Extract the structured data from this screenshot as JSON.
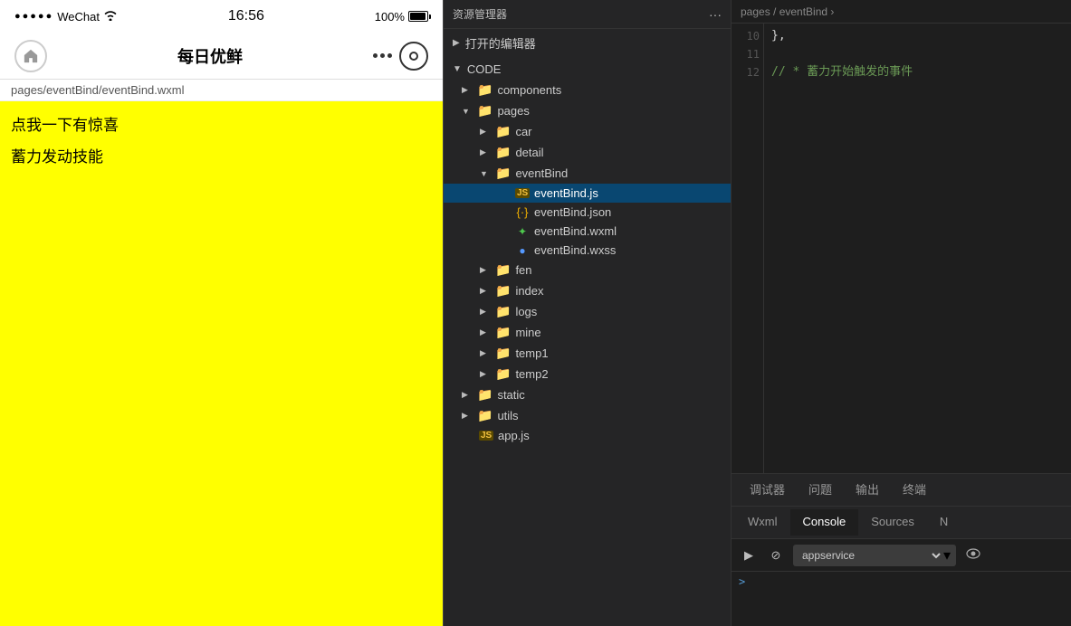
{
  "mobile": {
    "status": {
      "signal_dots": "●●●●●",
      "app_name": "WeChat",
      "wifi_icon": "wifi",
      "time": "16:56",
      "battery_pct": "100%"
    },
    "nav": {
      "title": "每日优鲜",
      "home_icon": "↑",
      "more_label": "···",
      "record_icon": "○"
    },
    "breadcrumb": "pages/eventBind/eventBind.wxml",
    "content": {
      "line1": "点我一下有惊喜",
      "line2": "蓄力发动技能"
    }
  },
  "explorer": {
    "header_title": "资源管理器",
    "header_more": "···",
    "open_editors_label": "打开的编辑器",
    "code_label": "CODE",
    "tree": {
      "components": {
        "label": "components",
        "type": "folder"
      },
      "pages": {
        "label": "pages",
        "type": "folder",
        "children": {
          "car": "car",
          "detail": "detail",
          "eventBind": {
            "label": "eventBind",
            "files": [
              "eventBind.js",
              "eventBind.json",
              "eventBind.wxml",
              "eventBind.wxss"
            ]
          },
          "fen": "fen",
          "index": "index",
          "logs": "logs",
          "mine": "mine",
          "temp1": "temp1",
          "temp2": "temp2"
        }
      },
      "static": {
        "label": "static",
        "type": "folder"
      },
      "utils": {
        "label": "utils",
        "type": "folder"
      },
      "app_js": "app.js"
    }
  },
  "debug": {
    "breadcrumb": {
      "path": "pages / eventBind ›"
    },
    "code_lines": {
      "10": "  },",
      "11": "",
      "12": "  //  * 蓄力开始触发的事件"
    },
    "tabs": {
      "debugger": "调试器",
      "issues": "问题",
      "output": "输出",
      "terminal": "终端"
    },
    "panel_tabs": {
      "wxml": "Wxml",
      "console": "Console",
      "sources": "Sources",
      "network": "N"
    },
    "toolbar": {
      "run_icon": "▶",
      "stop_icon": "⊘",
      "select_value": "appservice",
      "eye_icon": "👁",
      "chevron_icon": "▾"
    },
    "console_prompt": ">"
  }
}
